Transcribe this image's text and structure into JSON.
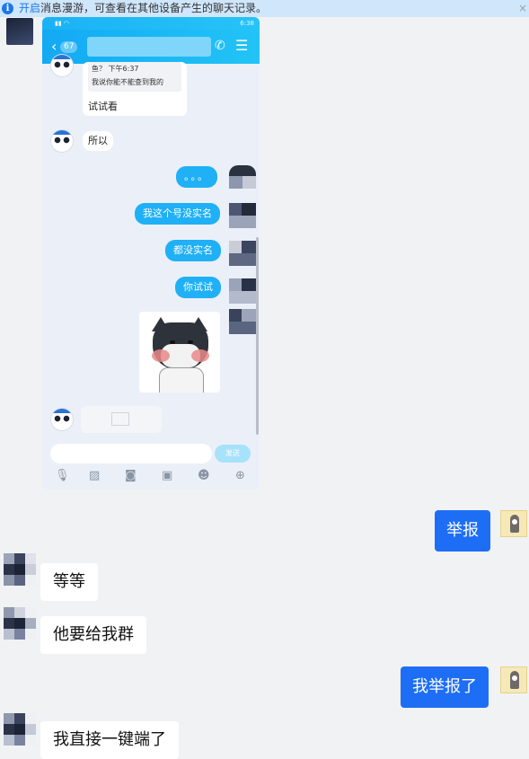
{
  "banner": {
    "info_icon": "i",
    "link": "开启",
    "message": "消息漫游，可查看在其他设备产生的聊天记录。",
    "close": "×"
  },
  "phone": {
    "status_right": "6:38",
    "header": {
      "back_icon": "‹",
      "unread_count": "67",
      "call_icon": "✆",
      "menu_icon": "☰"
    },
    "quote": {
      "line1": "鱼？ 下午6:37",
      "line2": "我说你能不能查到我的",
      "reply": "试试看"
    },
    "messages": [
      {
        "side": "left",
        "text": "所以"
      },
      {
        "side": "right",
        "text": "。。。"
      },
      {
        "side": "right",
        "text": "我这个号没实名"
      },
      {
        "side": "right",
        "text": "都没实名"
      },
      {
        "side": "right",
        "text": "你试试"
      }
    ],
    "send_label": "发送",
    "toolbar_icons": [
      "mic-icon",
      "image-icon",
      "camera-icon",
      "red-packet-icon",
      "emoji-icon",
      "plus-icon"
    ]
  },
  "chat": [
    {
      "side": "right",
      "text": "举报"
    },
    {
      "side": "left",
      "text": "等等"
    },
    {
      "side": "left",
      "text": "他要给我群"
    },
    {
      "side": "right",
      "text": "我举报了"
    },
    {
      "side": "left",
      "text": "我直接一键端了"
    }
  ],
  "colors": {
    "accent": "#1e6ef5",
    "phone_header": "#13a9f4",
    "banner_bg": "#cfe6fb"
  }
}
